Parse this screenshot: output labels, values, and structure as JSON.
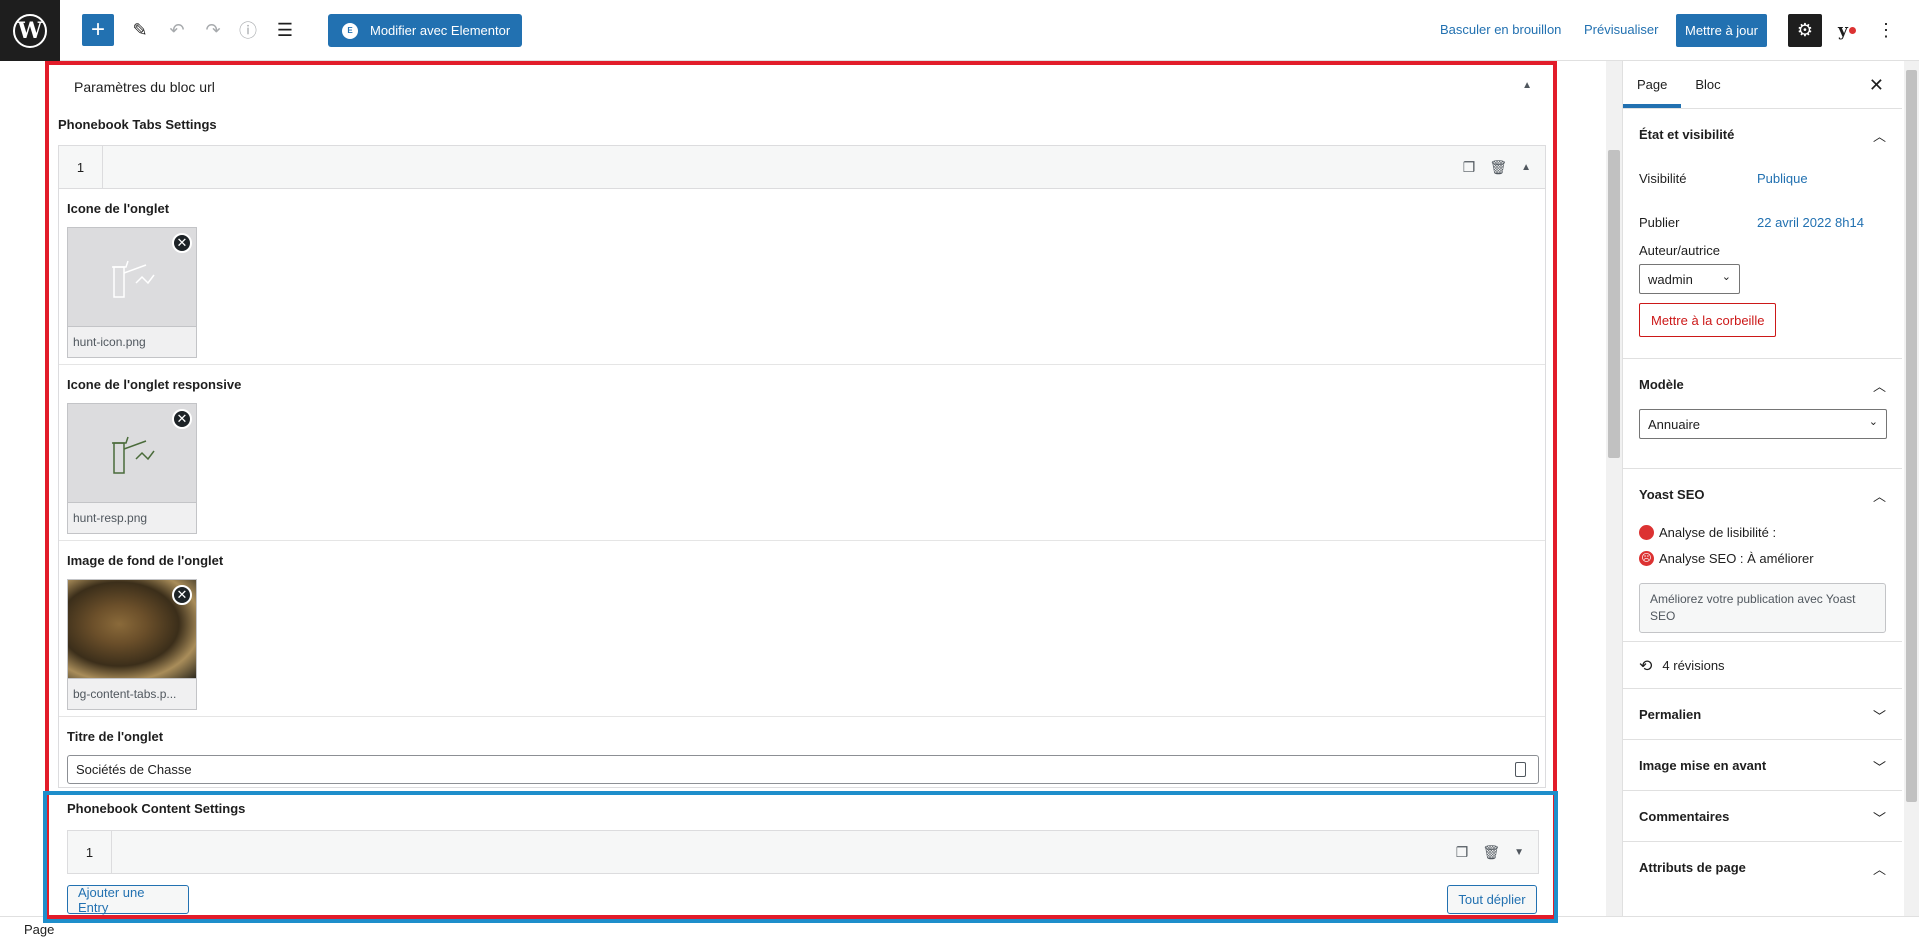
{
  "toolbar": {
    "elementor_label": "Modifier avec Elementor",
    "draft_label": "Basculer en brouillon",
    "preview_label": "Prévisualiser",
    "publish_label": "Mettre à jour"
  },
  "block": {
    "panel_title": "Paramètres du bloc url",
    "tabs_settings_title": "Phonebook Tabs Settings",
    "row_number": "1",
    "fields": {
      "icon_label": "Icone de l'onglet",
      "icon_file": "hunt-icon.png",
      "icon_resp_label": "Icone de l'onglet responsive",
      "icon_resp_file": "hunt-resp.png",
      "bg_label": "Image de fond de l'onglet",
      "bg_file": "bg-content-tabs.p...",
      "title_label": "Titre de l'onglet",
      "title_value": "Sociétés de Chasse"
    },
    "content_settings_title": "Phonebook Content Settings",
    "content_row_number": "1",
    "add_entry_label": "Ajouter une Entry",
    "expand_all_label": "Tout déplier"
  },
  "sidebar": {
    "tab_page": "Page",
    "tab_block": "Bloc",
    "status": {
      "title": "État et visibilité",
      "visibility_key": "Visibilité",
      "visibility_value": "Publique",
      "publish_key": "Publier",
      "publish_value": "22 avril 2022 8h14",
      "author_key": "Auteur/autrice",
      "author_value": "wadmin",
      "trash_label": "Mettre à la corbeille"
    },
    "template": {
      "title": "Modèle",
      "value": "Annuaire"
    },
    "yoast": {
      "title": "Yoast SEO",
      "readability": "Analyse de lisibilité :",
      "seo": "Analyse SEO : À améliorer",
      "improve": "Améliorez votre publication avec Yoast SEO"
    },
    "revisions": "4 révisions",
    "permalink": "Permalien",
    "featured_image": "Image mise en avant",
    "comments": "Commentaires",
    "page_attributes": "Attributs de page"
  },
  "footer": {
    "breadcrumb": "Page"
  },
  "colors": {
    "accent": "#2271b1",
    "red_frame": "#e21c2a",
    "blue_frame": "#1e8ecb",
    "danger": "#cc1818",
    "yoast_bad": "#dc3232"
  }
}
